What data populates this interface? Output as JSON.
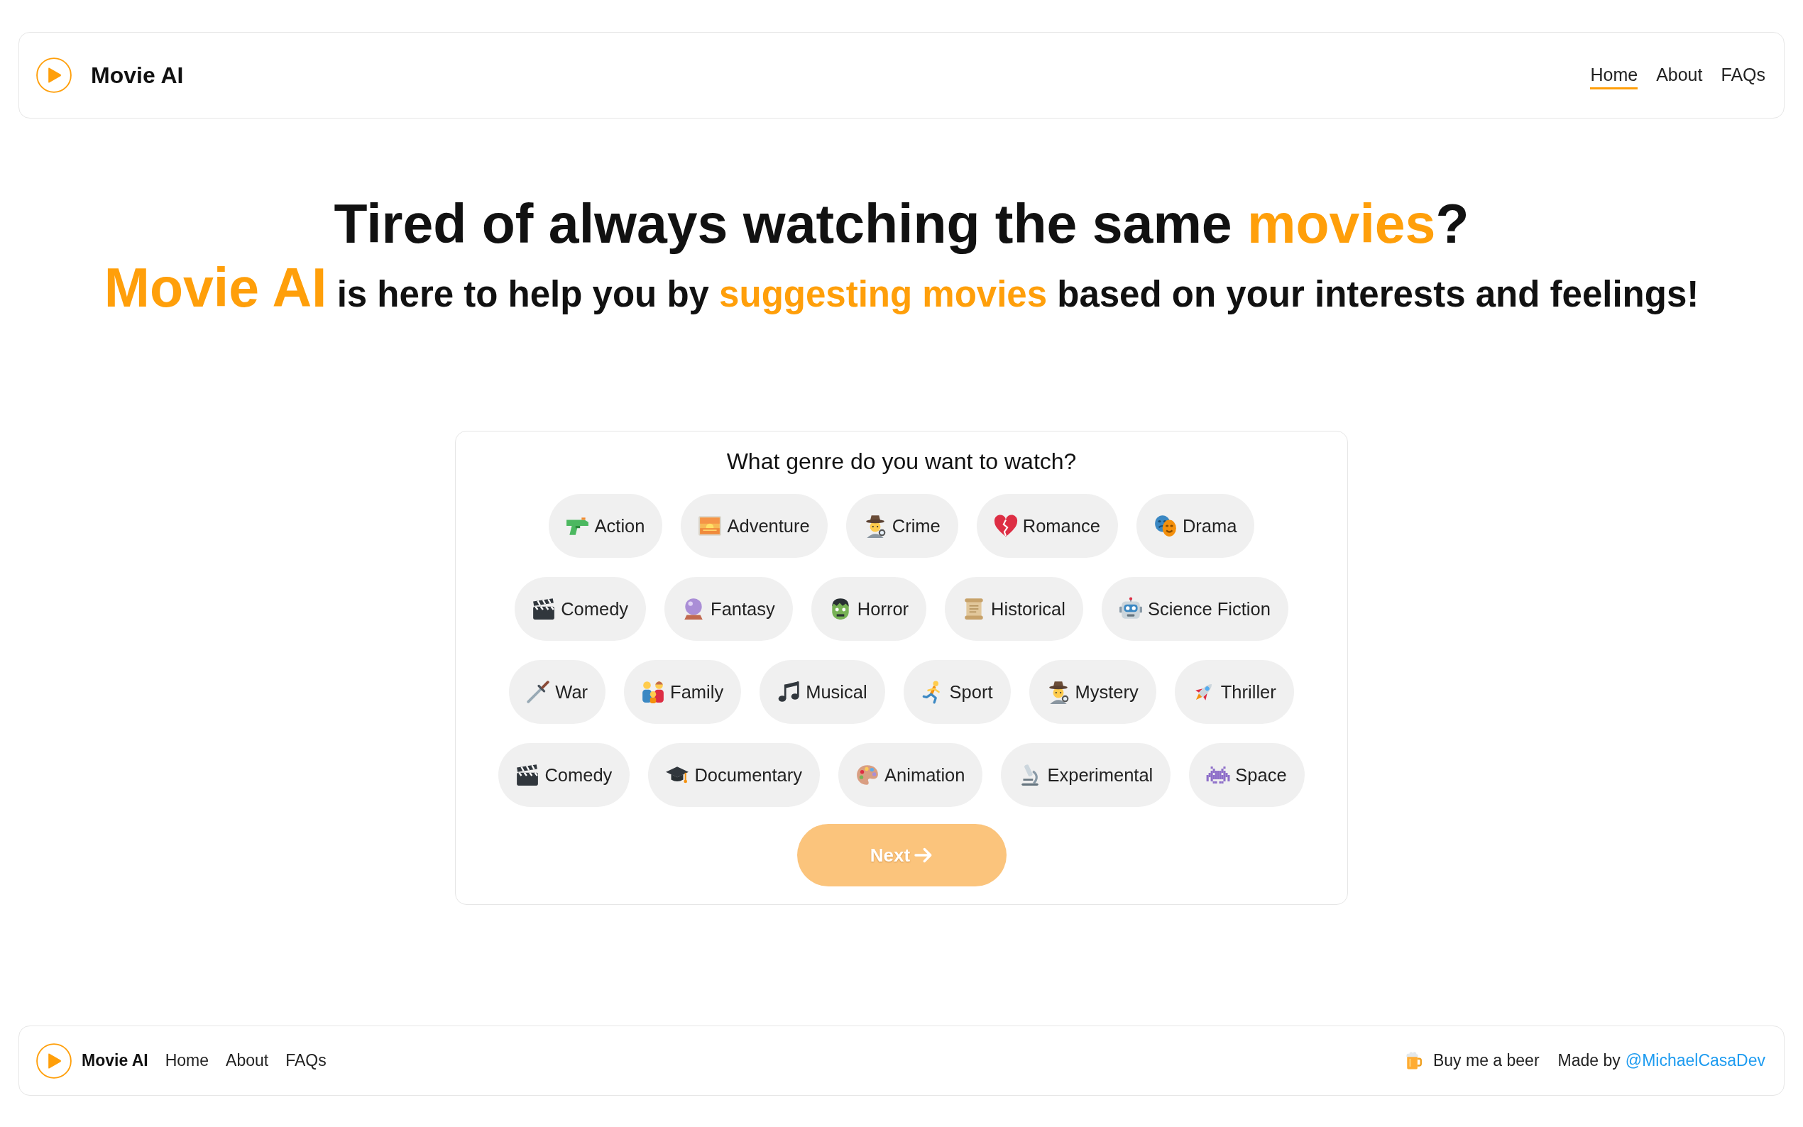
{
  "header": {
    "brand": "Movie AI",
    "nav": [
      {
        "label": "Home",
        "selected": true
      },
      {
        "label": "About",
        "selected": false
      },
      {
        "label": "FAQs",
        "selected": false
      }
    ]
  },
  "hero": {
    "headline": [
      {
        "text": "Tired of always watching the same ",
        "kind": "plain"
      },
      {
        "text": "movies",
        "kind": "accent"
      },
      {
        "text": "?",
        "kind": "plain"
      }
    ],
    "tagline": [
      {
        "text": "Movie AI",
        "kind": "brand"
      },
      {
        "text": " is here to help you by ",
        "kind": "plain"
      },
      {
        "text": "suggesting movies",
        "kind": "accent"
      },
      {
        "text": " based on your interests and feelings!",
        "kind": "plain"
      }
    ]
  },
  "genre_picker": {
    "question": "What genre do you want to watch?",
    "genre_rows": [
      [
        {
          "label": "Action",
          "selected": false
        },
        {
          "label": "Adventure",
          "selected": false
        },
        {
          "label": "Crime",
          "selected": false
        },
        {
          "label": "Romance",
          "selected": false
        },
        {
          "label": "Drama",
          "selected": false
        }
      ],
      [
        {
          "label": "Comedy",
          "selected": false
        },
        {
          "label": "Fantasy",
          "selected": false
        },
        {
          "label": "Horror",
          "selected": false
        },
        {
          "label": "Historical",
          "selected": false
        },
        {
          "label": "Science Fiction",
          "selected": false
        }
      ],
      [
        {
          "label": "War",
          "selected": false
        },
        {
          "label": "Family",
          "selected": false
        },
        {
          "label": "Musical",
          "selected": false
        },
        {
          "label": "Sport",
          "selected": false
        },
        {
          "label": "Mystery",
          "selected": false
        },
        {
          "label": "Thriller",
          "selected": false
        }
      ],
      [
        {
          "label": "Comedy",
          "selected": false
        },
        {
          "label": "Documentary",
          "selected": false
        },
        {
          "label": "Animation",
          "selected": false
        },
        {
          "label": "Experimental",
          "selected": false
        },
        {
          "label": "Space",
          "selected": false
        }
      ]
    ],
    "next_button": {
      "label": "Next",
      "disabled": true
    }
  },
  "footer": {
    "brand": "Movie AI",
    "nav": [
      "Home",
      "About",
      "FAQs"
    ],
    "beer_link": "Buy me a beer",
    "credit": {
      "text": "Made by",
      "link": "@MichaelCasaDev"
    }
  }
}
